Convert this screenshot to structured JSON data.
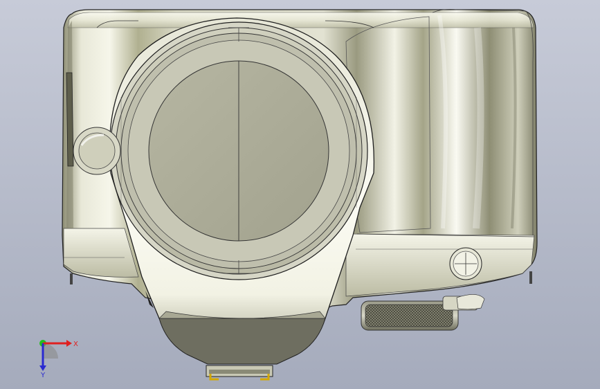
{
  "viewport": {
    "background_top": "#c7cbd8",
    "background_bottom": "#a5abbc"
  },
  "model": {
    "parts": [
      "camera-body",
      "grip",
      "lens-mount",
      "lens-cap",
      "mode-dial",
      "shutter-button",
      "release-button",
      "hot-shoe"
    ]
  },
  "triad": {
    "x_label": "X",
    "y_label": "Y",
    "x_color": "#e02020",
    "y_color": "#2a2ad0",
    "origin_color": "#20c020"
  }
}
